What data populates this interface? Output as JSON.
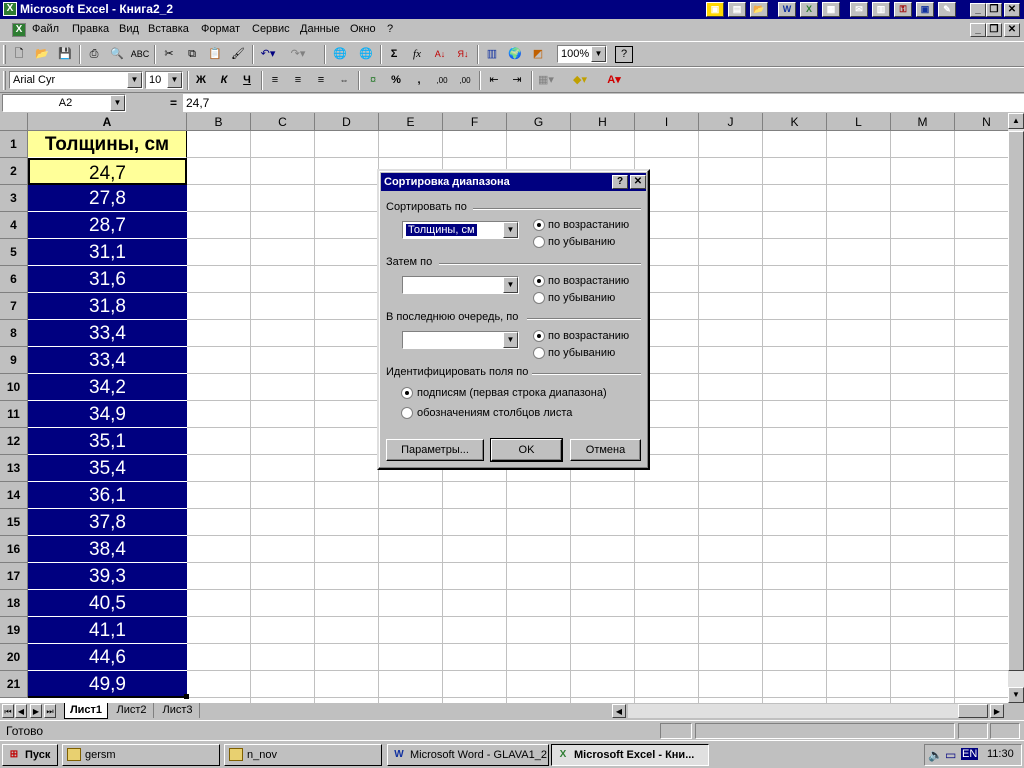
{
  "window": {
    "title": "Microsoft Excel - Книга2_2"
  },
  "menu": [
    "Файл",
    "Правка",
    "Вид",
    "Вставка",
    "Формат",
    "Сервис",
    "Данные",
    "Окно",
    "?"
  ],
  "formatting": {
    "font": "Arial Cyr",
    "size": "10",
    "zoom": "100%"
  },
  "formula_bar": {
    "name_box": "A2",
    "equals": "=",
    "content": "24,7"
  },
  "columns": [
    "A",
    "B",
    "C",
    "D",
    "E",
    "F",
    "G",
    "H",
    "I",
    "J",
    "K",
    "L",
    "M",
    "N"
  ],
  "rows": [
    "1",
    "2",
    "3",
    "4",
    "5",
    "6",
    "7",
    "8",
    "9",
    "10",
    "11",
    "12",
    "13",
    "14",
    "15",
    "16",
    "17",
    "18",
    "19",
    "20",
    "21"
  ],
  "column_a": [
    "Толщины, см",
    "24,7",
    "27,8",
    "28,7",
    "31,1",
    "31,6",
    "31,8",
    "33,4",
    "33,4",
    "34,2",
    "34,9",
    "35,1",
    "35,4",
    "36,1",
    "37,8",
    "38,4",
    "39,3",
    "40,5",
    "41,1",
    "44,6",
    "49,9"
  ],
  "dialog": {
    "title": "Сортировка диапазона",
    "sort_by_label": "Сортировать по",
    "sort_by_value": "Толщины, см",
    "then_by_label": "Затем по",
    "last_by_label": "В последнюю очередь, по",
    "ascending": "по возрастанию",
    "descending": "по убыванию",
    "identify_label": "Идентифицировать поля по",
    "header_option": "подписям (первая строка диапазона)",
    "column_option": "обозначениям столбцов листа",
    "params_button": "Параметры...",
    "ok_button": "OK",
    "cancel_button": "Отмена"
  },
  "sheets": [
    "Лист1",
    "Лист2",
    "Лист3"
  ],
  "status": "Готово",
  "taskbar": {
    "start": "Пуск",
    "tasks": [
      "gersm",
      "n_nov",
      "Microsoft Word - GLAVA1_2",
      "Microsoft Excel - Кни..."
    ],
    "lang": "EN",
    "clock": "11:30"
  },
  "colors": {
    "title_bar": "#000080",
    "selection": "#000080",
    "header_fill": "#ffff99",
    "active_cell_fill": "#ffff99"
  }
}
